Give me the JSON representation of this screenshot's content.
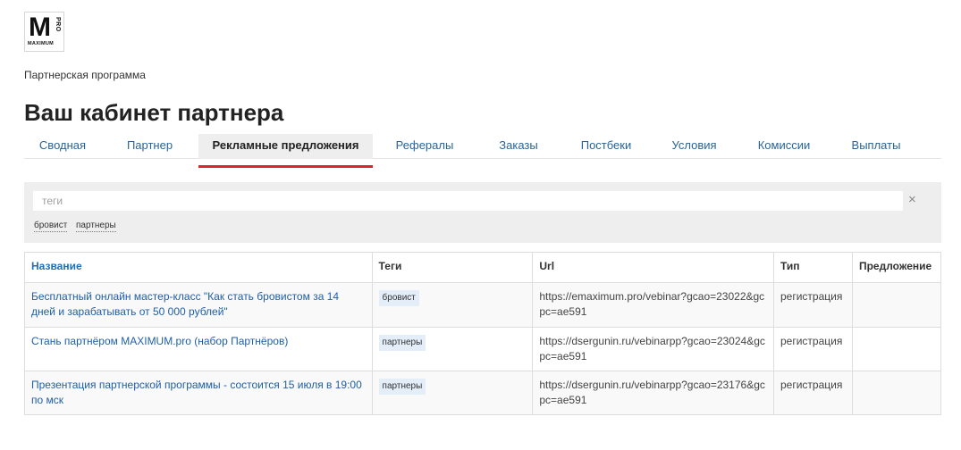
{
  "logo": {
    "letter": "M",
    "pro": "PRO",
    "word": "MAXIMUM"
  },
  "breadcrumb": "Партнерская программа",
  "page_title": "Ваш кабинет партнера",
  "tabs": [
    {
      "label": "Сводная",
      "active": false
    },
    {
      "label": "Партнер",
      "active": false
    },
    {
      "label": "Рекламные предложения",
      "active": true
    },
    {
      "label": "Рефералы",
      "active": false
    },
    {
      "label": "Заказы",
      "active": false
    },
    {
      "label": "Постбеки",
      "active": false
    },
    {
      "label": "Условия",
      "active": false
    },
    {
      "label": "Комиссии",
      "active": false
    },
    {
      "label": "Выплаты",
      "active": false
    }
  ],
  "filter": {
    "placeholder": "теги",
    "value": "",
    "clear_symbol": "×",
    "tags": [
      "бровист",
      "партнеры"
    ]
  },
  "table": {
    "headers": {
      "name": "Название",
      "tags": "Теги",
      "url": "Url",
      "type": "Тип",
      "offer": "Предложение"
    },
    "rows": [
      {
        "name": "Бесплатный онлайн мастер-класс \"Как стать бровистом за 14 дней и зарабатывать от 50 000 рублей\"",
        "tag": "бровист",
        "url": "https://emaximum.pro/vebinar?gcao=23022&gcpc=ae591",
        "type": "регистрация",
        "offer": ""
      },
      {
        "name": "Стань партнёром MAXIMUM.pro (набор Партнёров)",
        "tag": "партнеры",
        "url": "https://dsergunin.ru/vebinarpp?gcao=23024&gcpc=ae591",
        "type": "регистрация",
        "offer": ""
      },
      {
        "name": "Презентация партнерской программы - состоится 15 июля в 19:00 по мск",
        "tag": "партнеры",
        "url": "https://dsergunin.ru/vebinarpp?gcao=23176&gcpc=ae591",
        "type": "регистрация",
        "offer": ""
      }
    ]
  },
  "colors": {
    "link": "#1f5fa5",
    "accent": "#d9262c",
    "panel": "#eeeeee",
    "tag_bg": "#e4eef8"
  }
}
